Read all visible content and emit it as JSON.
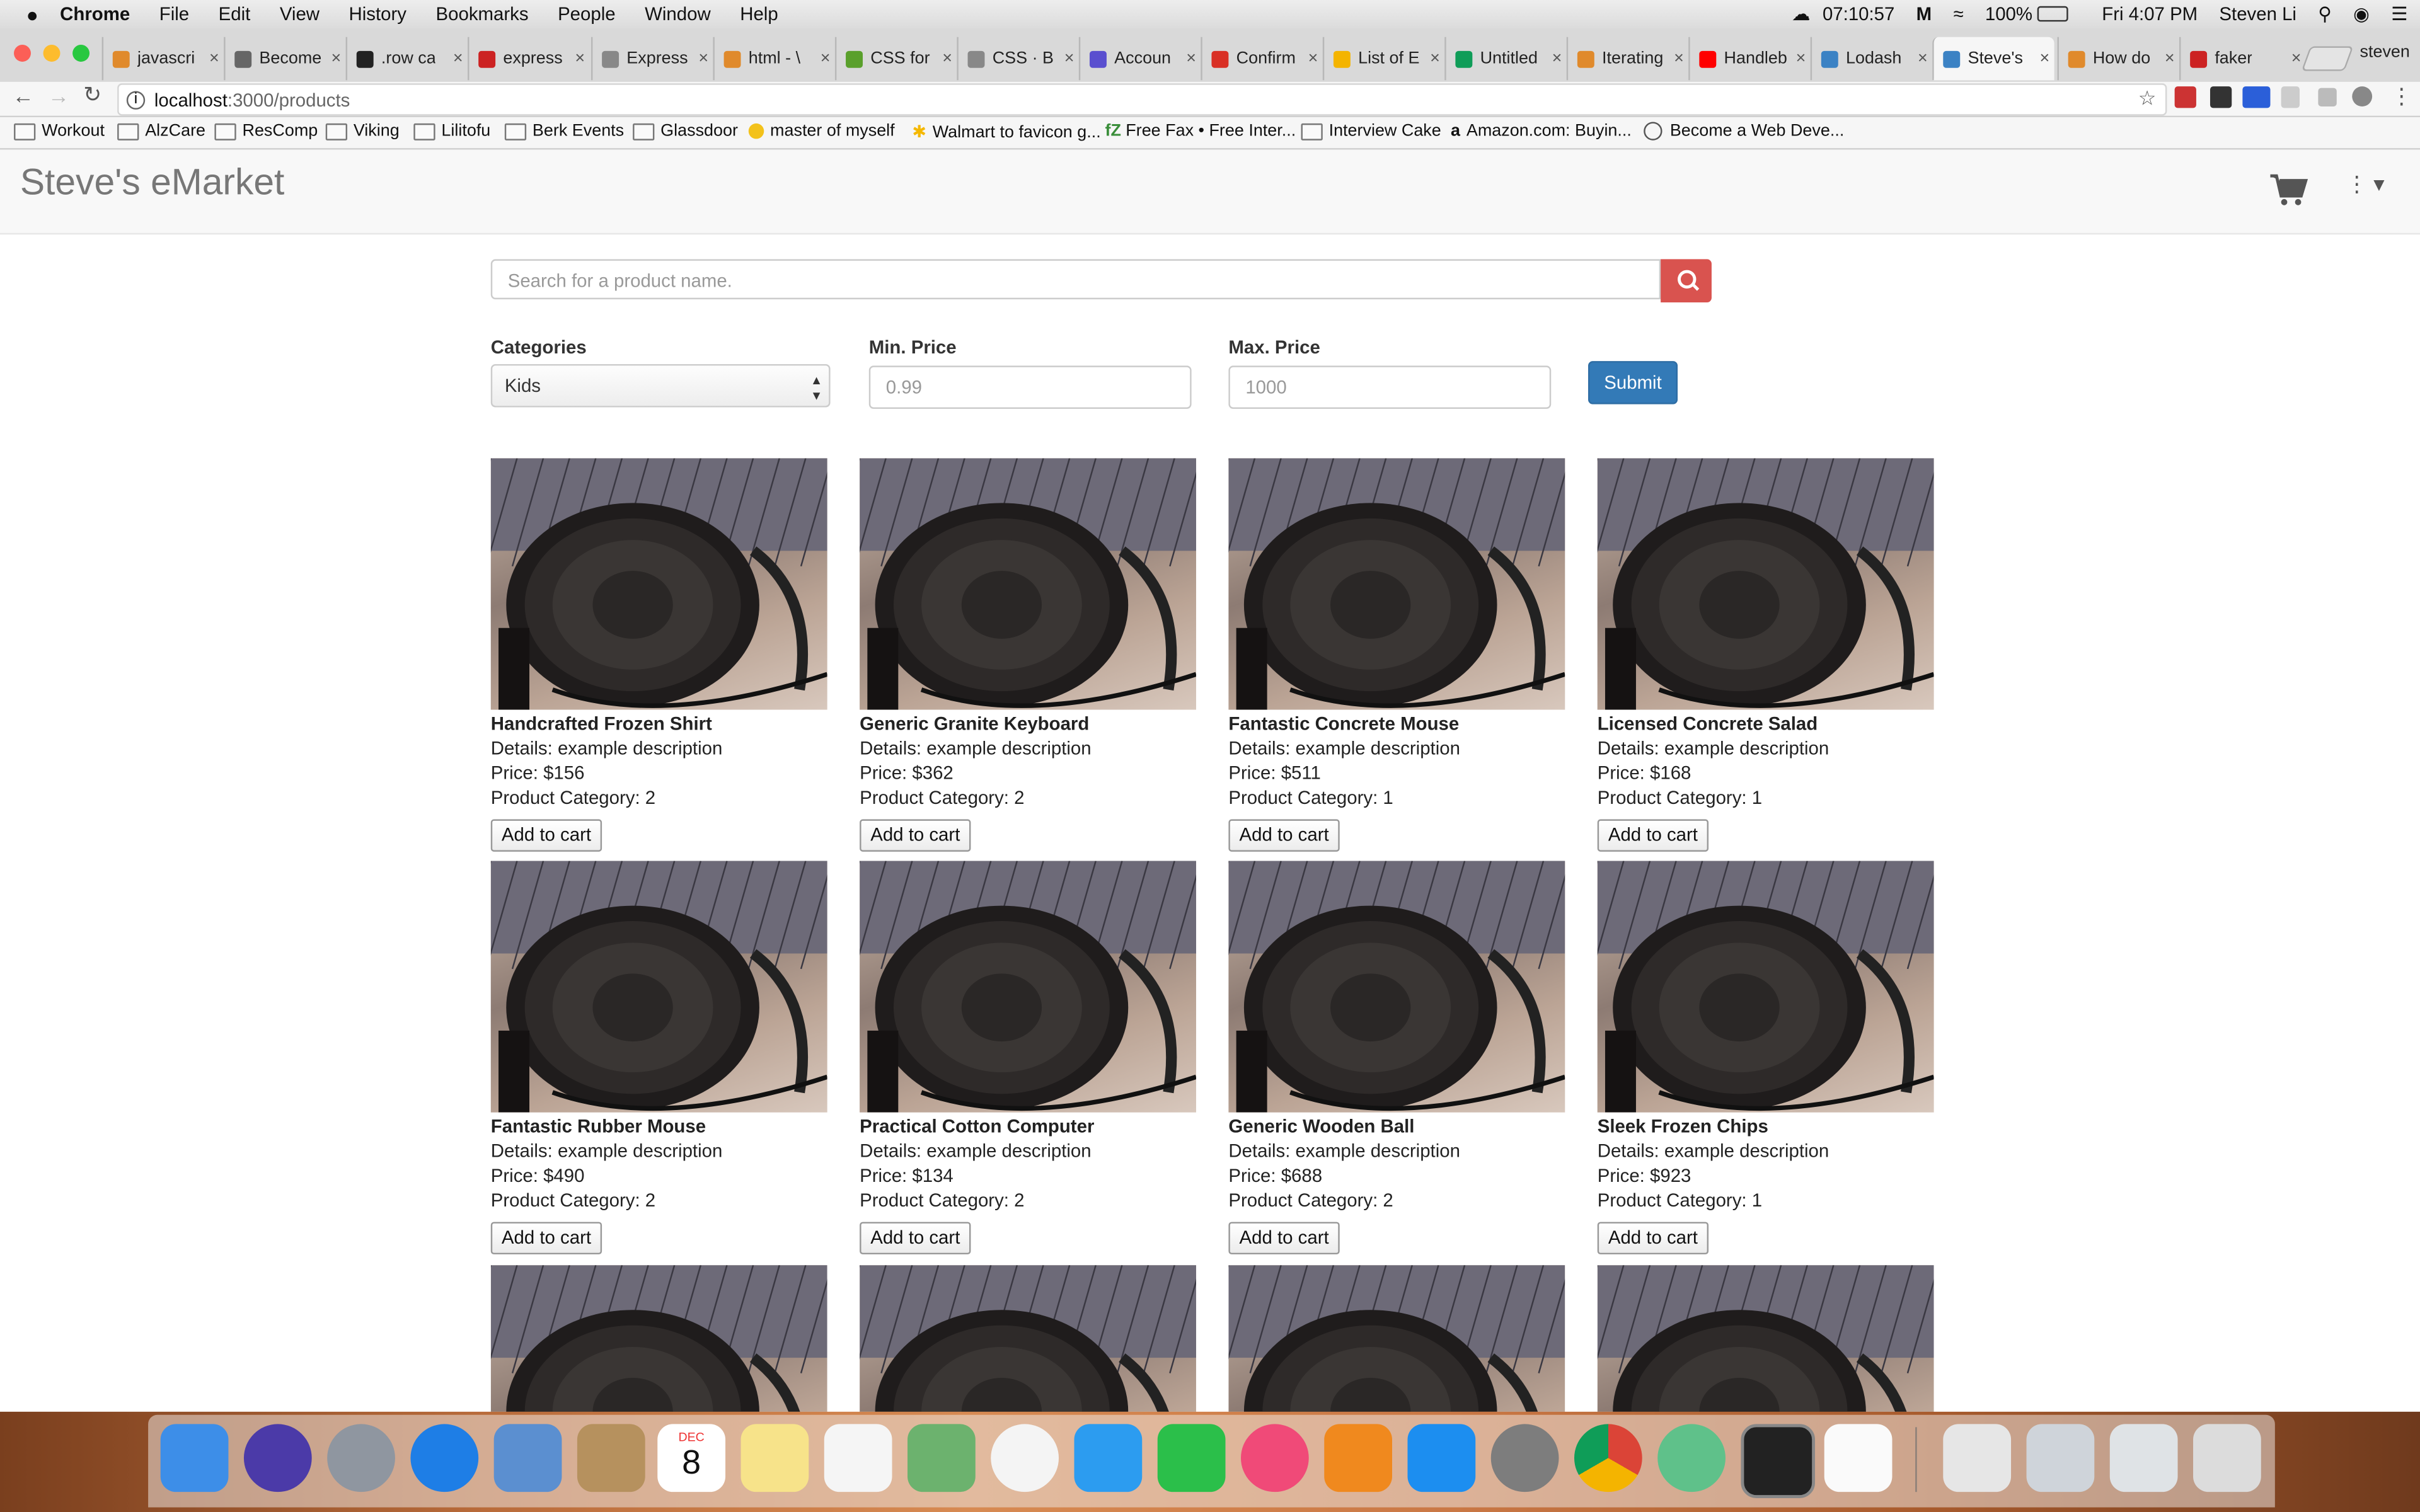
{
  "menubar": {
    "app": "Chrome",
    "items": [
      "File",
      "Edit",
      "View",
      "History",
      "Bookmarks",
      "People",
      "Window",
      "Help"
    ],
    "timer": "07:10:57",
    "battery": "100%",
    "clock": "Fri 4:07 PM",
    "user": "Steven Li"
  },
  "tabs": [
    {
      "label": "javascri",
      "color": "#e08a2c"
    },
    {
      "label": "Become",
      "color": "#666"
    },
    {
      "label": ".row ca",
      "color": "#222"
    },
    {
      "label": "express",
      "color": "#cc2222"
    },
    {
      "label": "Express",
      "color": "#888"
    },
    {
      "label": "html - \\",
      "color": "#e08a2c"
    },
    {
      "label": "CSS for",
      "color": "#5aa02c"
    },
    {
      "label": "CSS · B",
      "color": "#888"
    },
    {
      "label": "Accoun",
      "color": "#5a4fcf"
    },
    {
      "label": "Confirm",
      "color": "#d93025"
    },
    {
      "label": "List of E",
      "color": "#f4b400"
    },
    {
      "label": "Untitled",
      "color": "#0f9d58"
    },
    {
      "label": "Iterating",
      "color": "#e08a2c"
    },
    {
      "label": "Handleb",
      "color": "#ff0000"
    },
    {
      "label": "Lodash",
      "color": "#3b82c4"
    },
    {
      "label": "Steve's",
      "color": "#3b82c4"
    },
    {
      "label": "How do",
      "color": "#e08a2c"
    },
    {
      "label": "faker",
      "color": "#cc2222"
    }
  ],
  "profile": "steven",
  "address": {
    "host": "localhost",
    "path": ":3000/products"
  },
  "bookmarks": [
    "Workout",
    "AlzCare",
    "ResComp",
    "Viking",
    "Lilitofu",
    "Berk Events",
    "Glassdoor",
    "master of myself",
    "Walmart to favicon g...",
    "Free Fax • Free Inter...",
    "Interview Cake",
    "Amazon.com: Buyin...",
    "Become a Web Deve..."
  ],
  "page": {
    "brand": "Steve's eMarket",
    "search_placeholder": "Search for a product name.",
    "labels": {
      "categories": "Categories",
      "min": "Min. Price",
      "max": "Max. Price"
    },
    "category_value": "Kids",
    "min_placeholder": "0.99",
    "max_placeholder": "1000",
    "submit": "Submit"
  },
  "products": [
    {
      "name": "Handcrafted Frozen Shirt",
      "details": "Details: example description",
      "price": "Price: $156",
      "category": "Product Category: 2",
      "button": "Add to cart"
    },
    {
      "name": "Generic Granite Keyboard",
      "details": "Details: example description",
      "price": "Price: $362",
      "category": "Product Category: 2",
      "button": "Add to cart"
    },
    {
      "name": "Fantastic Concrete Mouse",
      "details": "Details: example description",
      "price": "Price: $511",
      "category": "Product Category: 1",
      "button": "Add to cart"
    },
    {
      "name": "Licensed Concrete Salad",
      "details": "Details: example description",
      "price": "Price: $168",
      "category": "Product Category: 1",
      "button": "Add to cart"
    },
    {
      "name": "Fantastic Rubber Mouse",
      "details": "Details: example description",
      "price": "Price: $490",
      "category": "Product Category: 2",
      "button": "Add to cart"
    },
    {
      "name": "Practical Cotton Computer",
      "details": "Details: example description",
      "price": "Price: $134",
      "category": "Product Category: 2",
      "button": "Add to cart"
    },
    {
      "name": "Generic Wooden Ball",
      "details": "Details: example description",
      "price": "Price: $688",
      "category": "Product Category: 2",
      "button": "Add to cart"
    },
    {
      "name": "Sleek Frozen Chips",
      "details": "Details: example description",
      "price": "Price: $923",
      "category": "Product Category: 1",
      "button": "Add to cart"
    }
  ],
  "dock": {
    "calendar_month": "DEC",
    "calendar_day": "8",
    "icons": [
      "finder-icon",
      "siri-icon",
      "launchpad-icon",
      "safari-icon",
      "mail-icon",
      "contacts-icon",
      "calendar-icon",
      "notes-icon",
      "reminders-icon",
      "maps-icon",
      "photos-icon",
      "messages-icon",
      "facetime-icon",
      "itunes-icon",
      "ibooks-icon",
      "app-store-icon",
      "system-preferences-icon",
      "chrome-icon",
      "atom-icon",
      "terminal-icon",
      "textedit-icon",
      "document-icon",
      "screenshot-icon",
      "screenshot-icon",
      "trash-icon"
    ],
    "colors": [
      "#3d8ee8",
      "#4b3aa8",
      "#8f96a0",
      "#1e7ee6",
      "#5b8fd0",
      "#b6915e",
      "#ffffff",
      "#f7e38a",
      "#f5f5f5",
      "#6cb26e",
      "#f4f4f4",
      "#2c9cf0",
      "#2bbf4a",
      "#f04a78",
      "#f0891e",
      "#1c8ef0",
      "#7d7d7d",
      "#f2f2f2",
      "#5fc18a",
      "#222222",
      "#fafafa",
      "#e6e6e6",
      "#cfd4da",
      "#dfe3e6",
      "#dcdcdc"
    ]
  }
}
